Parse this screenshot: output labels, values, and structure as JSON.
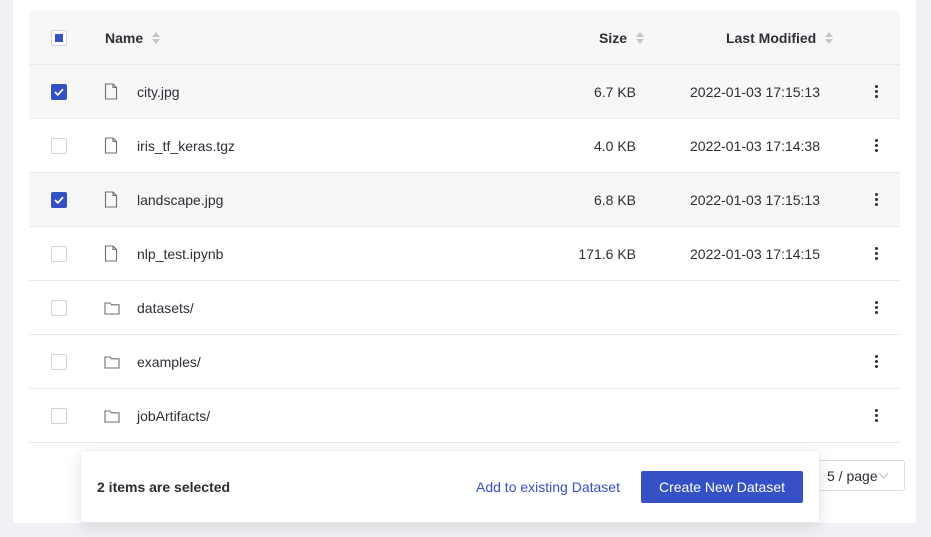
{
  "table": {
    "columns": {
      "name": "Name",
      "size": "Size",
      "modified": "Last Modified"
    },
    "rows": [
      {
        "type": "file",
        "name": "city.jpg",
        "size": "6.7 KB",
        "modified": "2022-01-03 17:15:13",
        "selected": true
      },
      {
        "type": "file",
        "name": "iris_tf_keras.tgz",
        "size": "4.0 KB",
        "modified": "2022-01-03 17:14:38",
        "selected": false
      },
      {
        "type": "file",
        "name": "landscape.jpg",
        "size": "6.8 KB",
        "modified": "2022-01-03 17:15:13",
        "selected": true
      },
      {
        "type": "file",
        "name": "nlp_test.ipynb",
        "size": "171.6 KB",
        "modified": "2022-01-03 17:14:15",
        "selected": false
      },
      {
        "type": "folder",
        "name": "datasets/",
        "size": "",
        "modified": "",
        "selected": false
      },
      {
        "type": "folder",
        "name": "examples/",
        "size": "",
        "modified": "",
        "selected": false
      },
      {
        "type": "folder",
        "name": "jobArtifacts/",
        "size": "",
        "modified": "",
        "selected": false
      }
    ]
  },
  "pagination": {
    "page_size_label": "5 / page"
  },
  "selection_bar": {
    "message": "2 items are selected",
    "add_existing_label": "Add to existing Dataset",
    "create_new_label": "Create New Dataset"
  },
  "colors": {
    "accent": "#3650c5"
  }
}
